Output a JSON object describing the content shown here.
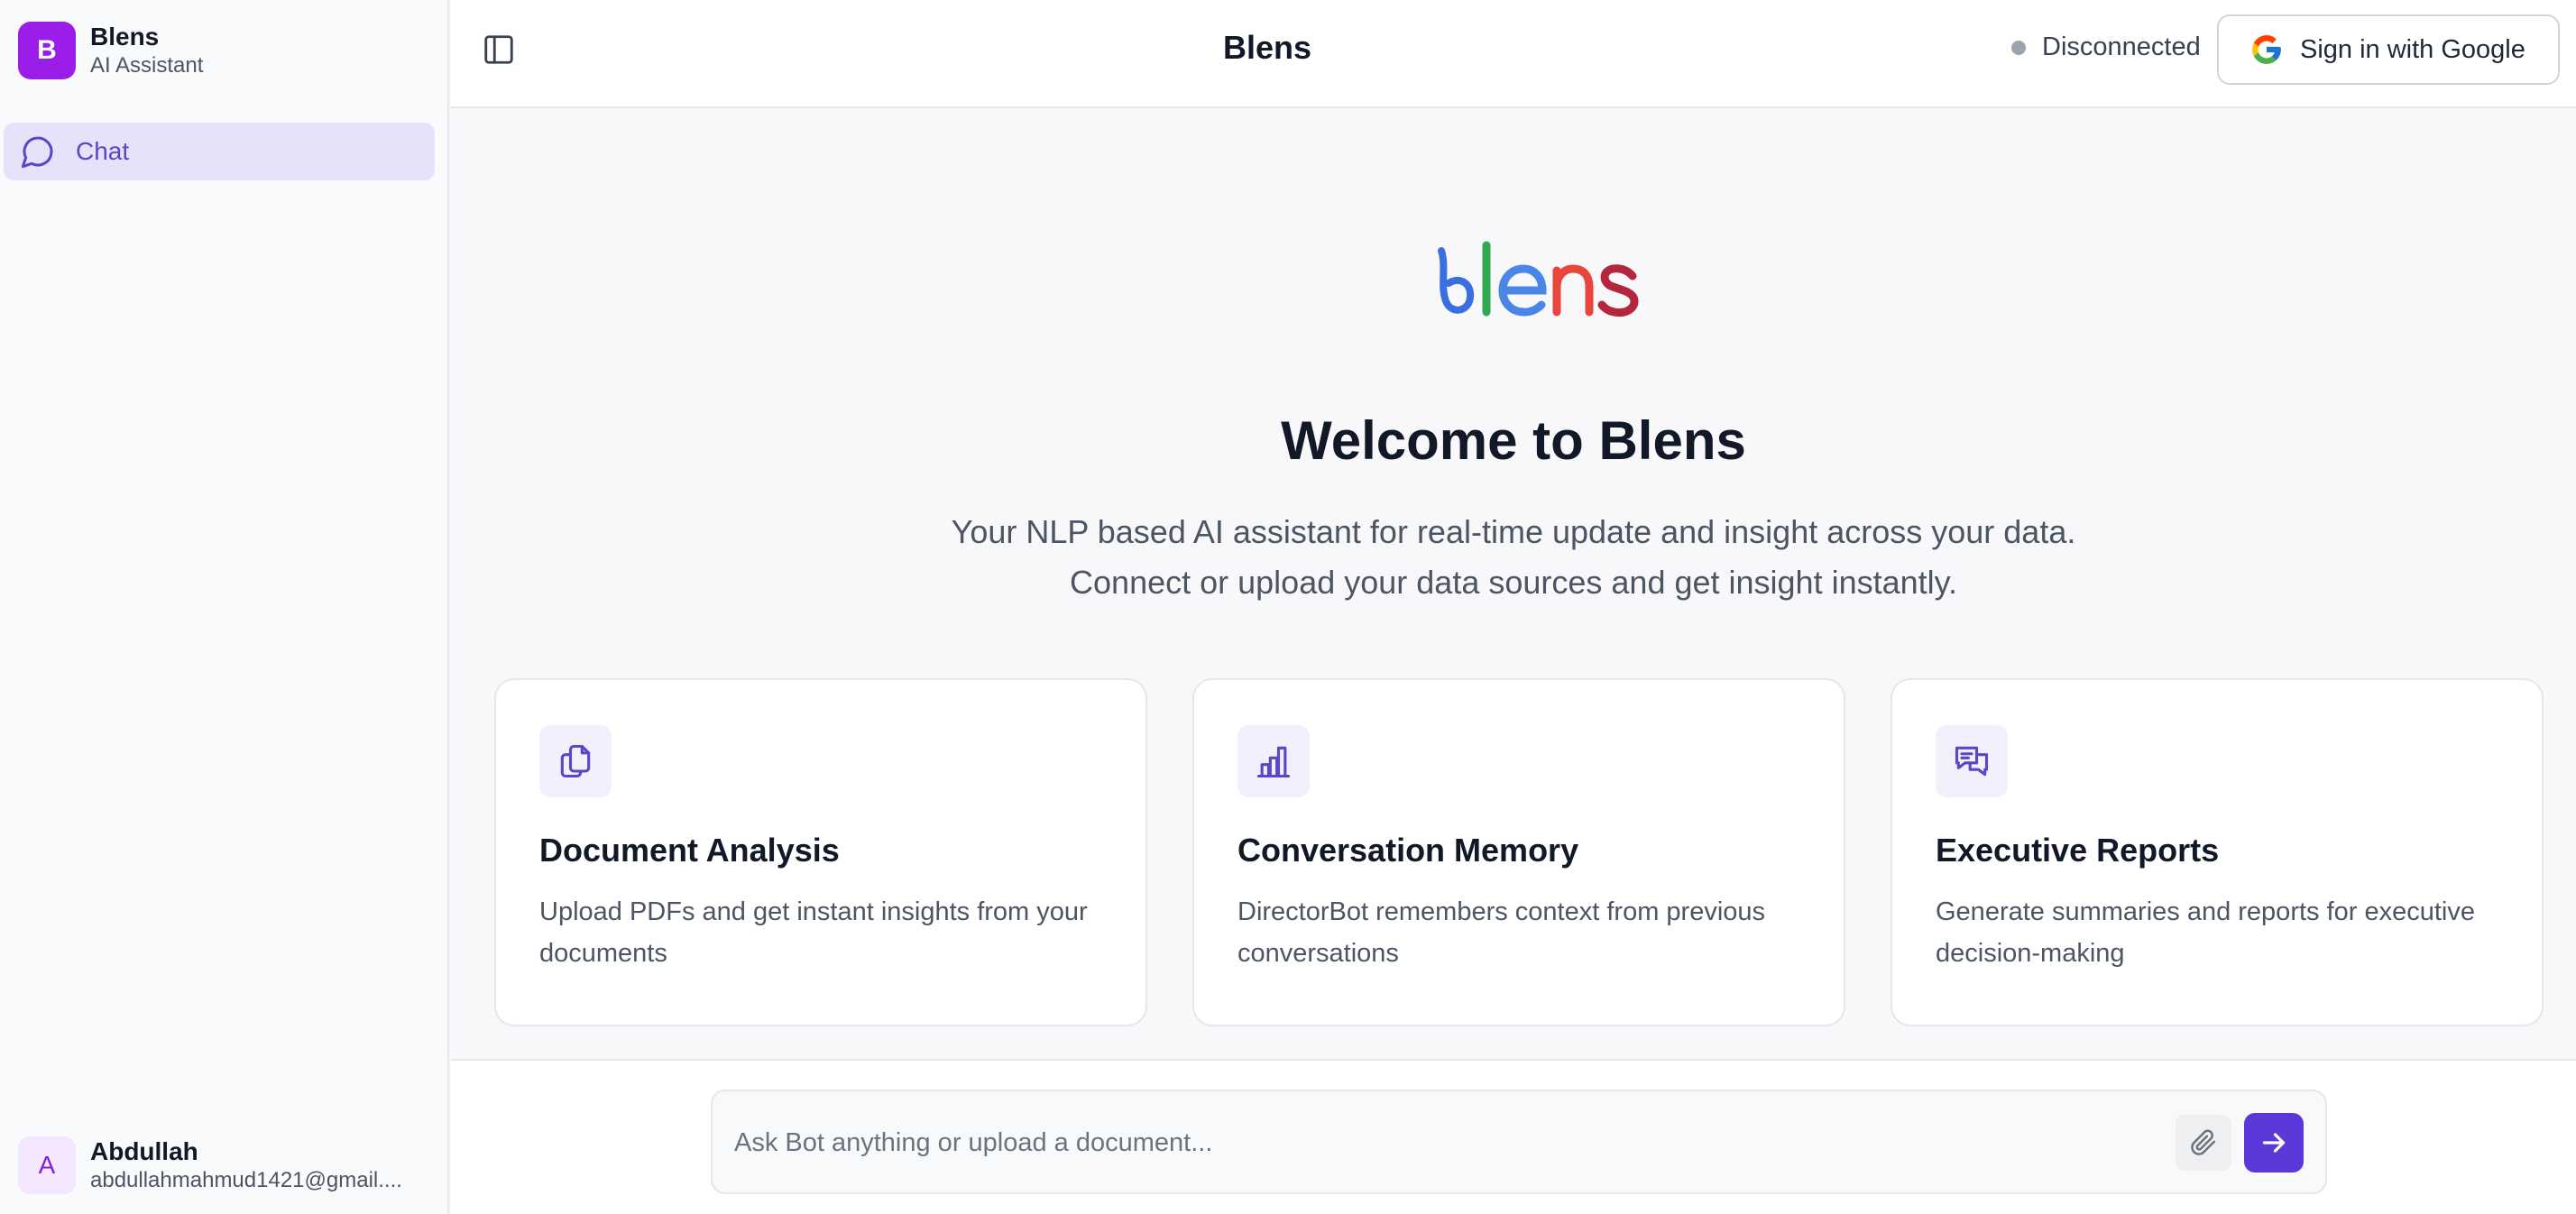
{
  "sidebar": {
    "brand": {
      "initial": "B",
      "name": "Blens",
      "subtitle": "AI Assistant"
    },
    "nav": [
      {
        "label": "Chat",
        "icon": "chat-bubble-icon",
        "active": true
      }
    ],
    "user": {
      "initial": "A",
      "name": "Abdullah",
      "email": "abdullahmahmud1421@gmail...."
    }
  },
  "header": {
    "title": "Blens",
    "status": "Disconnected",
    "signin_label": "Sign in with Google"
  },
  "main": {
    "logo_text": "blens",
    "welcome": "Welcome to Blens",
    "subtitle_line1": "Your NLP based AI assistant for real-time update and insight across your data.",
    "subtitle_line2": "Connect or upload your data sources and get insight instantly.",
    "cards": [
      {
        "icon": "documents-icon",
        "title": "Document Analysis",
        "description": "Upload PDFs and get instant insights from your documents"
      },
      {
        "icon": "bar-chart-icon",
        "title": "Conversation Memory",
        "description": "DirectorBot remembers context from previous conversations"
      },
      {
        "icon": "messages-icon",
        "title": "Executive Reports",
        "description": "Generate summaries and reports for executive decision-making"
      }
    ]
  },
  "composer": {
    "placeholder": "Ask Bot anything or upload a document..."
  },
  "colors": {
    "accent": "#5b39d8",
    "brand_avatar": "#9b1de8",
    "nav_active_bg": "#e6e2f9",
    "status_dot": "#9ca3af"
  }
}
